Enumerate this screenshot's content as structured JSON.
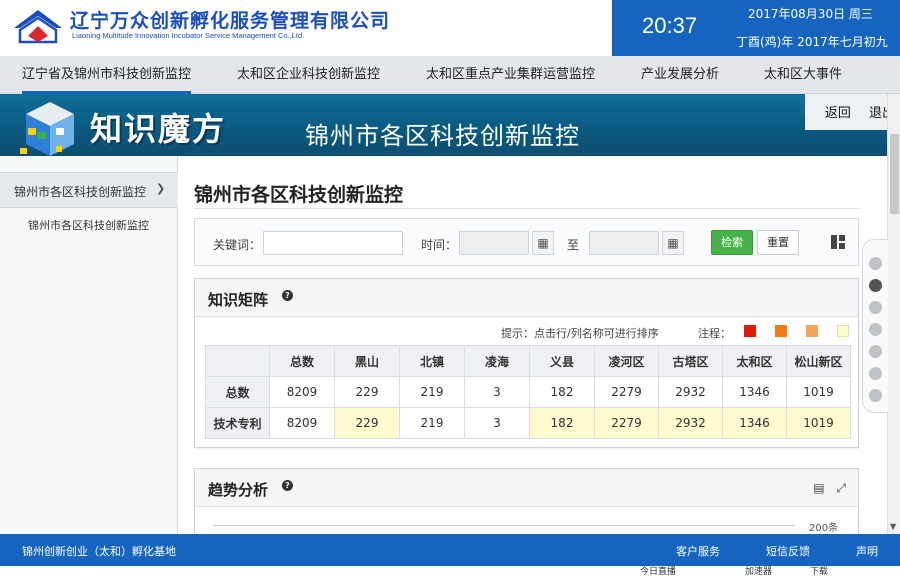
{
  "header": {
    "company_cn": "辽宁万众创新孵化服务管理有限公司",
    "company_en": "Liaoning Multitude Innovation Incubator Service Management Co.,Ltd.",
    "time": "20:37",
    "date": "2017年08月30日 周三",
    "lunar": "丁酉(鸡)年 2017年七月初九",
    "brand_color": "#1565c0"
  },
  "topnav": {
    "items": [
      "辽宁省及锦州市科技创新监控",
      "太和区企业科技创新监控",
      "太和区重点产业集群运营监控",
      "产业发展分析",
      "太和区大事件"
    ],
    "active_index": 0
  },
  "banner": {
    "brand": "知识魔方",
    "title": "锦州市各区科技创新监控",
    "back": "返回",
    "exit": "退出"
  },
  "sidebar": {
    "group": "锦州市各区科技创新监控",
    "chevron_icon": "chevron-down-icon",
    "item": "锦州市各区科技创新监控"
  },
  "main": {
    "title": "锦州市各区科技创新监控"
  },
  "filter": {
    "keyword_label": "关键词：",
    "keyword_value": "",
    "time_label": "时间：",
    "to_label": "至",
    "start_value": "",
    "end_value": "",
    "calendar_icon": "calendar-icon",
    "search": "检索",
    "reset": "重置",
    "grid_icon": "grid-view-icon"
  },
  "matrix": {
    "title": "知识矩阵",
    "help_icon": "help-icon",
    "hint": "提示：点击行/列名称可进行排序",
    "legend_label": "注程：",
    "legend_colors": [
      "#e01b0b",
      "#f47a1a",
      "#f5a55a",
      "#fdfbd0"
    ],
    "columns": [
      "总数",
      "黑山",
      "北镇",
      "凌海",
      "义县",
      "凌河区",
      "古塔区",
      "太和区",
      "松山新区"
    ],
    "rows": [
      {
        "label": "总数",
        "values": [
          "8209",
          "229",
          "219",
          "3",
          "182",
          "2279",
          "2932",
          "1346",
          "1019"
        ]
      },
      {
        "label": "技术专利",
        "values": [
          "8209",
          "229",
          "219",
          "3",
          "182",
          "2279",
          "2932",
          "1346",
          "1019"
        ]
      }
    ]
  },
  "trend": {
    "title": "趋势分析",
    "help_icon": "help-icon",
    "table_icon": "table-icon",
    "expand_icon": "expand-icon",
    "tick": "200条"
  },
  "side_dots": {
    "count": 7,
    "active_index": 1
  },
  "footer": {
    "org": "锦州创新创业（太和）孵化基地",
    "service": "客户服务",
    "feedback": "短信反馈",
    "statement": "声明"
  },
  "statusbar": {
    "items": [
      "今日直播",
      "加速器",
      "下载"
    ]
  }
}
